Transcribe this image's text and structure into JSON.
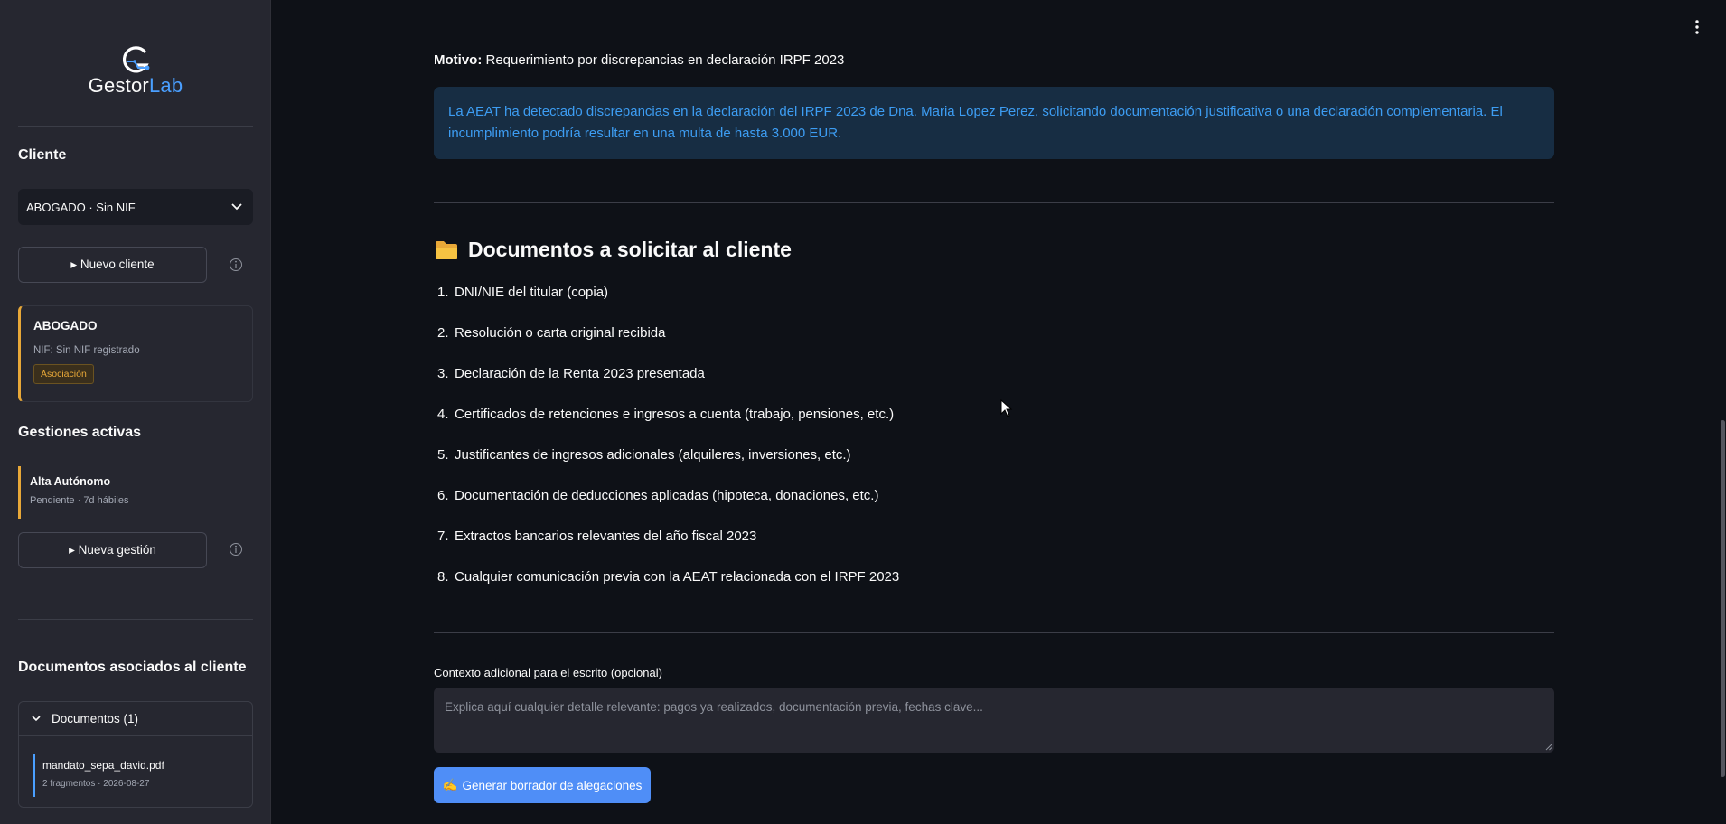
{
  "app": {
    "logo_text_main": "Gestor",
    "logo_text_accent": "Lab",
    "brand_color": "#4a9fff"
  },
  "sidebar": {
    "cliente_heading": "Cliente",
    "cliente_select": {
      "value": "ABOGADO · Sin NIF"
    },
    "new_client_button": "▸ Nuevo cliente",
    "client_card": {
      "name": "ABOGADO",
      "nif": "NIF: Sin NIF registrado",
      "badge": "Asociación",
      "accent_color": "#e8a838"
    },
    "gestiones_heading": "Gestiones activas",
    "gestiones": [
      {
        "title": "Alta Autónomo",
        "subtitle": "Pendiente · 7d hábiles"
      }
    ],
    "new_gestion_button": "▸ Nueva gestión",
    "documents_heading": "Documentos asociados al cliente",
    "documents_expander": {
      "label": "Documentos (1)",
      "items": [
        {
          "name": "mandato_sepa_david.pdf",
          "meta": "2 fragmentos · 2026-08-27"
        }
      ]
    }
  },
  "main": {
    "motivo_label": "Motivo:",
    "motivo_text": " Requerimiento por discrepancias en declaración IRPF 2023",
    "info_text": "La AEAT ha detectado discrepancias en la declaración del IRPF 2023 de Dna. Maria Lopez Perez, solicitando documentación justificativa o una declaración complementaria. El incumplimiento podría resultar en una multa de hasta 3.000 EUR.",
    "section_title": "Documentos a solicitar al cliente",
    "documents": [
      {
        "num": "1.",
        "text": "DNI/NIE del titular (copia)"
      },
      {
        "num": "2.",
        "text": "Resolución o carta original recibida"
      },
      {
        "num": "3.",
        "text": "Declaración de la Renta 2023 presentada"
      },
      {
        "num": "4.",
        "text": "Certificados de retenciones e ingresos a cuenta (trabajo, pensiones, etc.)"
      },
      {
        "num": "5.",
        "text": "Justificantes de ingresos adicionales (alquileres, inversiones, etc.)"
      },
      {
        "num": "6.",
        "text": "Documentación de deducciones aplicadas (hipoteca, donaciones, etc.)"
      },
      {
        "num": "7.",
        "text": "Extractos bancarios relevantes del año fiscal 2023"
      },
      {
        "num": "8.",
        "text": "Cualquier comunicación previa con la AEAT relacionada con el IRPF 2023"
      }
    ],
    "context_label": "Contexto adicional para el escrito (opcional)",
    "context_placeholder": "Explica aquí cualquier detalle relevante: pagos ya realizados, documentación previa, fechas clave...",
    "generate_button": "Generar borrador de alegaciones",
    "generate_button_icon": "✍️"
  }
}
